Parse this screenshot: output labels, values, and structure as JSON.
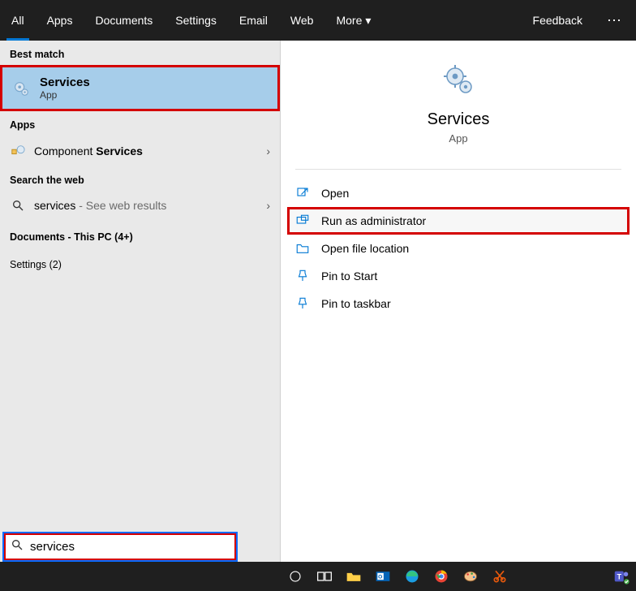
{
  "tabs": {
    "all": "All",
    "apps": "Apps",
    "documents": "Documents",
    "settings": "Settings",
    "email": "Email",
    "web": "Web",
    "more": "More",
    "feedback": "Feedback"
  },
  "left": {
    "best_match_label": "Best match",
    "best_match": {
      "title": "Services",
      "subtitle": "App"
    },
    "apps_label": "Apps",
    "component_prefix": "Component ",
    "component_bold": "Services",
    "search_web_label": "Search the web",
    "web_query": "services",
    "web_suffix": " - See web results",
    "documents_label": "Documents - This PC (4+)",
    "settings_label": "Settings (2)"
  },
  "right": {
    "title": "Services",
    "subtitle": "App",
    "actions": {
      "open": "Open",
      "run_admin": "Run as administrator",
      "open_location": "Open file location",
      "pin_start": "Pin to Start",
      "pin_taskbar": "Pin to taskbar"
    }
  },
  "search": {
    "value": "services"
  }
}
